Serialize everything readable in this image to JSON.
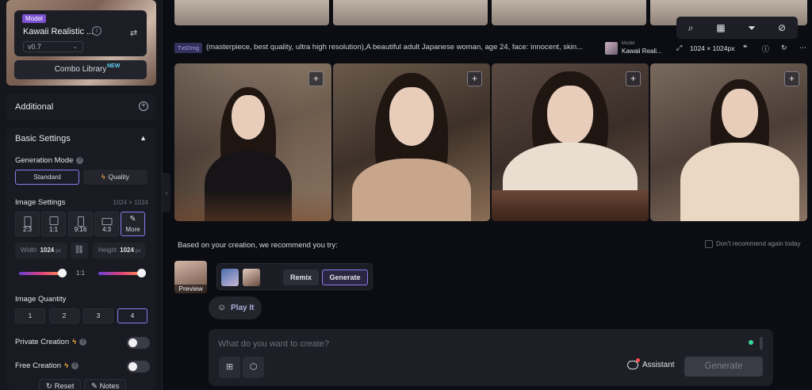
{
  "sidebar": {
    "model_tag": "Model",
    "model_name": "Kawaii Realistic ...",
    "model_version": "v0.7",
    "combo_library": "Combo Library",
    "combo_badge": "NEW",
    "additional_label": "Additional",
    "basic_settings_label": "Basic Settings",
    "generation_mode_label": "Generation Mode",
    "generation_modes": [
      {
        "label": "Standard",
        "selected": true
      },
      {
        "label": "Quality",
        "selected": false
      }
    ],
    "image_settings_label": "Image Settings",
    "image_size_note": "1024 × 1024",
    "ratios": [
      {
        "label": "2:3"
      },
      {
        "label": "1:1"
      },
      {
        "label": "9:16"
      },
      {
        "label": "4:3"
      },
      {
        "label": "More",
        "selected": true
      }
    ],
    "width_label": "Width",
    "width_value": "1024",
    "height_label": "Height",
    "height_value": "1024",
    "unit": "px",
    "ratio_readout": "1:1",
    "image_quantity_label": "Image Quantity",
    "quantities": [
      {
        "label": "1"
      },
      {
        "label": "2"
      },
      {
        "label": "3"
      },
      {
        "label": "4",
        "selected": true
      }
    ],
    "private_creation_label": "Private Creation",
    "free_creation_label": "Free Creation",
    "reset_label": "Reset",
    "notes_label": "Notes"
  },
  "toolbar": {
    "icons": [
      "search-icon",
      "grid-icon",
      "filter-icon",
      "eye-off-icon"
    ]
  },
  "result": {
    "type_badge": "Txt2Img",
    "prompt": "(masterpiece, best quality, ultra high resolution),A beautiful adult Japanese woman, age 24,   face: innocent, skin...",
    "model_label": "Model",
    "model_name": "Kawaii Reali...",
    "size": "1024 × 1024px"
  },
  "recommend": {
    "text": "Based on your creation, we recommend you try:",
    "dont_recommend": "Don't recommend again today",
    "preview_label": "Preview",
    "remix_label": "Remix",
    "generate_label": "Generate",
    "play_label": "Play It"
  },
  "composer": {
    "placeholder": "What do you want to create?",
    "assistant_label": "Assistant",
    "generate_label": "Generate"
  },
  "colors": {
    "accent": "#8b7cf0",
    "background": "#0c0d12",
    "panel": "#1a1b22",
    "bolt": "#f2b23a",
    "status_green": "#3ad49a"
  }
}
